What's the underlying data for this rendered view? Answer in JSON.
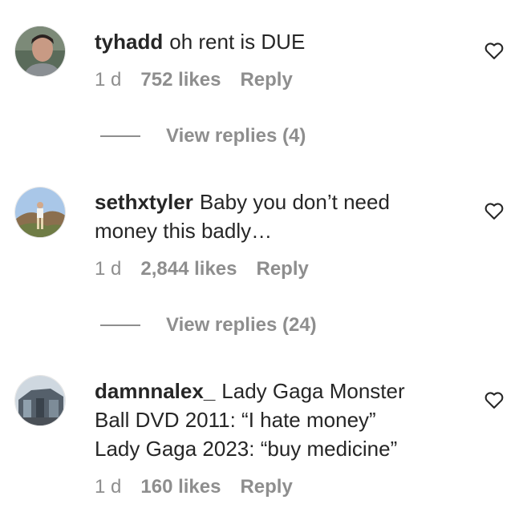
{
  "comments": [
    {
      "username": "tyhadd",
      "text": "oh rent is DUE",
      "time": "1 d",
      "likes": "752 likes",
      "reply": "Reply",
      "view_replies": "View replies (4)",
      "avatar_icon": "profile-photo"
    },
    {
      "username": "sethxtyler",
      "text": "Baby you don’t need money this badly…",
      "time": "1 d",
      "likes": "2,844 likes",
      "reply": "Reply",
      "view_replies": "View replies (24)",
      "avatar_icon": "profile-photo"
    },
    {
      "username": "damnnalex_",
      "text_lines": [
        "Lady Gaga Monster",
        "Ball DVD 2011: “I hate money”",
        "Lady Gaga 2023: “buy medicine”"
      ],
      "time": "1 d",
      "likes": "160 likes",
      "reply": "Reply",
      "avatar_icon": "profile-photo"
    }
  ],
  "icons": {
    "like": "heart-outline-icon"
  },
  "colors": {
    "text": "#262626",
    "secondary": "#8e8e8e",
    "background": "#ffffff"
  }
}
